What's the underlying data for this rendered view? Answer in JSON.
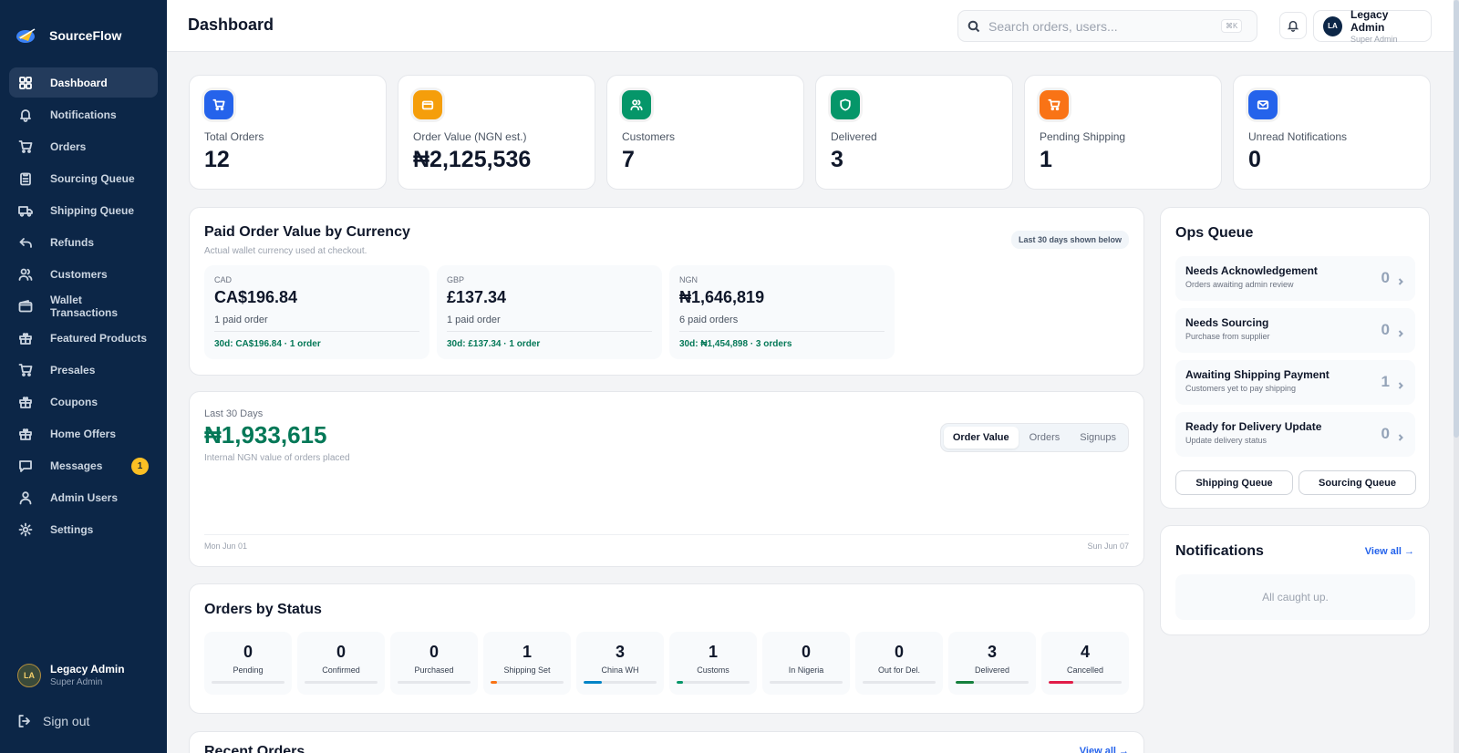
{
  "app": {
    "name": "SourceFlow"
  },
  "sidebar": {
    "items": [
      {
        "label": "Dashboard",
        "icon": "grid-icon",
        "active": true
      },
      {
        "label": "Notifications",
        "icon": "bell-icon"
      },
      {
        "label": "Orders",
        "icon": "cart-icon"
      },
      {
        "label": "Sourcing Queue",
        "icon": "clipboard-icon"
      },
      {
        "label": "Shipping Queue",
        "icon": "truck-icon"
      },
      {
        "label": "Refunds",
        "icon": "undo-icon"
      },
      {
        "label": "Customers",
        "icon": "users-icon"
      },
      {
        "label": "Wallet Transactions",
        "icon": "wallet-icon"
      },
      {
        "label": "Featured Products",
        "icon": "gift-icon"
      },
      {
        "label": "Presales",
        "icon": "cart-icon"
      },
      {
        "label": "Coupons",
        "icon": "gift-icon"
      },
      {
        "label": "Home Offers",
        "icon": "gift-icon"
      },
      {
        "label": "Messages",
        "icon": "message-icon",
        "badge": "1"
      },
      {
        "label": "Admin Users",
        "icon": "user-icon"
      },
      {
        "label": "Settings",
        "icon": "gear-icon"
      }
    ],
    "user": {
      "initials": "LA",
      "name": "Legacy Admin",
      "role": "Super Admin"
    },
    "signout": "Sign out"
  },
  "header": {
    "title": "Dashboard",
    "search_placeholder": "Search orders, users...",
    "search_shortcut": "⌘K",
    "user": {
      "initials": "LA",
      "name": "Legacy Admin",
      "role": "Super Admin"
    }
  },
  "stats": [
    {
      "label": "Total Orders",
      "value": "12",
      "color": "#2563eb",
      "icon": "cart-icon"
    },
    {
      "label": "Order Value (NGN est.)",
      "value": "₦2,125,536",
      "color": "#f59e0b",
      "icon": "wallet-icon"
    },
    {
      "label": "Customers",
      "value": "7",
      "color": "#059669",
      "icon": "users-icon"
    },
    {
      "label": "Delivered",
      "value": "3",
      "color": "#059669",
      "icon": "shield-icon"
    },
    {
      "label": "Pending Shipping",
      "value": "1",
      "color": "#f97316",
      "icon": "cart-icon"
    },
    {
      "label": "Unread Notifications",
      "value": "0",
      "color": "#2563eb",
      "icon": "mail-icon"
    }
  ],
  "currency": {
    "title": "Paid Order Value by Currency",
    "subtitle": "Actual wallet currency used at checkout.",
    "note": "Last 30 days shown below",
    "items": [
      {
        "code": "CAD",
        "amount": "CA$196.84",
        "count": "1 paid order",
        "last30": "30d: CA$196.84 · 1 order"
      },
      {
        "code": "GBP",
        "amount": "£137.34",
        "count": "1 paid order",
        "last30": "30d: £137.34 · 1 order"
      },
      {
        "code": "NGN",
        "amount": "₦1,646,819",
        "count": "6 paid orders",
        "last30": "30d: ₦1,454,898 · 3 orders"
      }
    ]
  },
  "trend": {
    "label": "Last 30 Days",
    "value": "₦1,933,615",
    "subtitle": "Internal NGN value of orders placed",
    "tabs": [
      "Order Value",
      "Orders",
      "Signups"
    ],
    "active_tab": "Order Value",
    "start_date": "Mon Jun 01",
    "end_date": "Sun Jun 07"
  },
  "status": {
    "title": "Orders by Status",
    "items": [
      {
        "name": "Pending",
        "count": "0",
        "fill": 0,
        "color": "#9ca3af"
      },
      {
        "name": "Confirmed",
        "count": "0",
        "fill": 0,
        "color": "#9ca3af"
      },
      {
        "name": "Purchased",
        "count": "0",
        "fill": 0,
        "color": "#9ca3af"
      },
      {
        "name": "Shipping Set",
        "count": "1",
        "fill": 0.0833,
        "color": "#f97316"
      },
      {
        "name": "China WH",
        "count": "3",
        "fill": 0.25,
        "color": "#0284c7"
      },
      {
        "name": "Customs",
        "count": "1",
        "fill": 0.0833,
        "color": "#059669"
      },
      {
        "name": "In Nigeria",
        "count": "0",
        "fill": 0,
        "color": "#9ca3af"
      },
      {
        "name": "Out for Del.",
        "count": "0",
        "fill": 0,
        "color": "#9ca3af"
      },
      {
        "name": "Delivered",
        "count": "3",
        "fill": 0.25,
        "color": "#15803d"
      },
      {
        "name": "Cancelled",
        "count": "4",
        "fill": 0.3333,
        "color": "#e11d48"
      }
    ]
  },
  "recent": {
    "title": "Recent Orders",
    "link": "View all →"
  },
  "ops": {
    "title": "Ops Queue",
    "items": [
      {
        "name": "Needs Acknowledgement",
        "desc": "Orders awaiting admin review",
        "count": "0"
      },
      {
        "name": "Needs Sourcing",
        "desc": "Purchase from supplier",
        "count": "0"
      },
      {
        "name": "Awaiting Shipping Payment",
        "desc": "Customers yet to pay shipping",
        "count": "1"
      },
      {
        "name": "Ready for Delivery Update",
        "desc": "Update delivery status",
        "count": "0"
      }
    ],
    "buttons": [
      "Shipping Queue",
      "Sourcing Queue"
    ]
  },
  "notifications": {
    "title": "Notifications",
    "link": "View all →",
    "empty": "All caught up."
  }
}
